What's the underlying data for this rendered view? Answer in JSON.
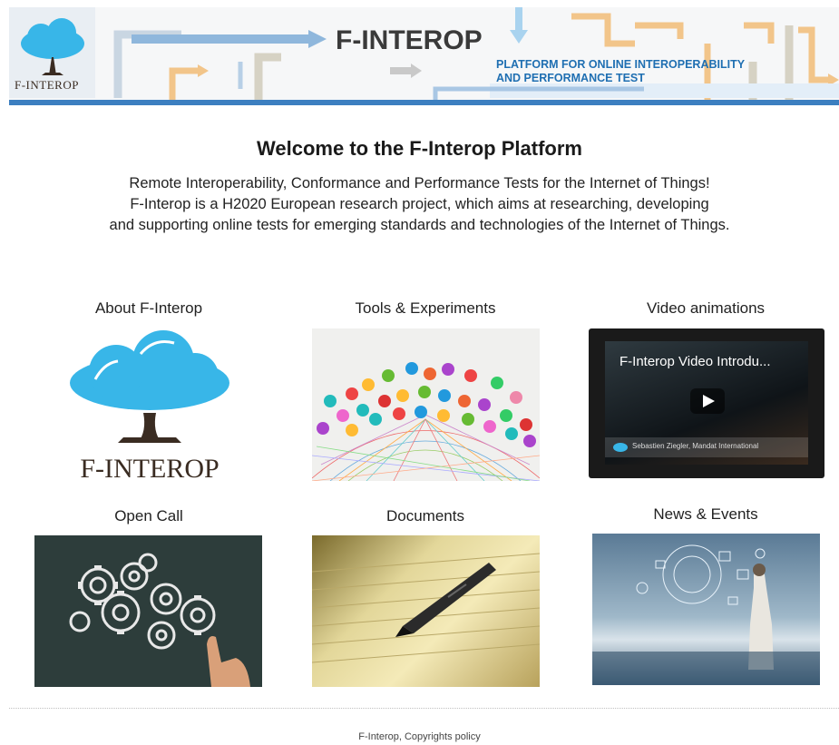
{
  "header": {
    "logo_text": "F-INTEROP",
    "title": "F-INTEROP",
    "tagline_line1": "PLATFORM FOR ONLINE INTEROPERABILITY",
    "tagline_line2": "AND PERFORMANCE TEST"
  },
  "intro": {
    "title": "Welcome to the F-Interop Platform",
    "line1": "Remote Interoperability, Conformance and Performance Tests for the Internet of Things!",
    "line2": "F-Interop is a H2020 European research project, which aims at researching, developing",
    "line3": "and supporting online tests for emerging standards and technologies of the Internet of Things."
  },
  "tiles": [
    {
      "title": "About F-Interop",
      "logo_text": "F-INTEROP"
    },
    {
      "title": "Tools & Experiments"
    },
    {
      "title": "Video animations",
      "video_title": "F-Interop Video Introdu...",
      "video_caption": "Sebastien Ziegler, Mandat International"
    },
    {
      "title": "Open Call"
    },
    {
      "title": "Documents"
    },
    {
      "title": "News & Events"
    }
  ],
  "footer": {
    "text": "F-Interop, Copyrights policy"
  },
  "colors": {
    "banner_blue": "#3c7fc0",
    "tagline_blue": "#1f6fb2",
    "cloud_blue": "#38b6e8",
    "trunk_brown": "#3a2c22",
    "arrow_orange": "#f0b060"
  }
}
